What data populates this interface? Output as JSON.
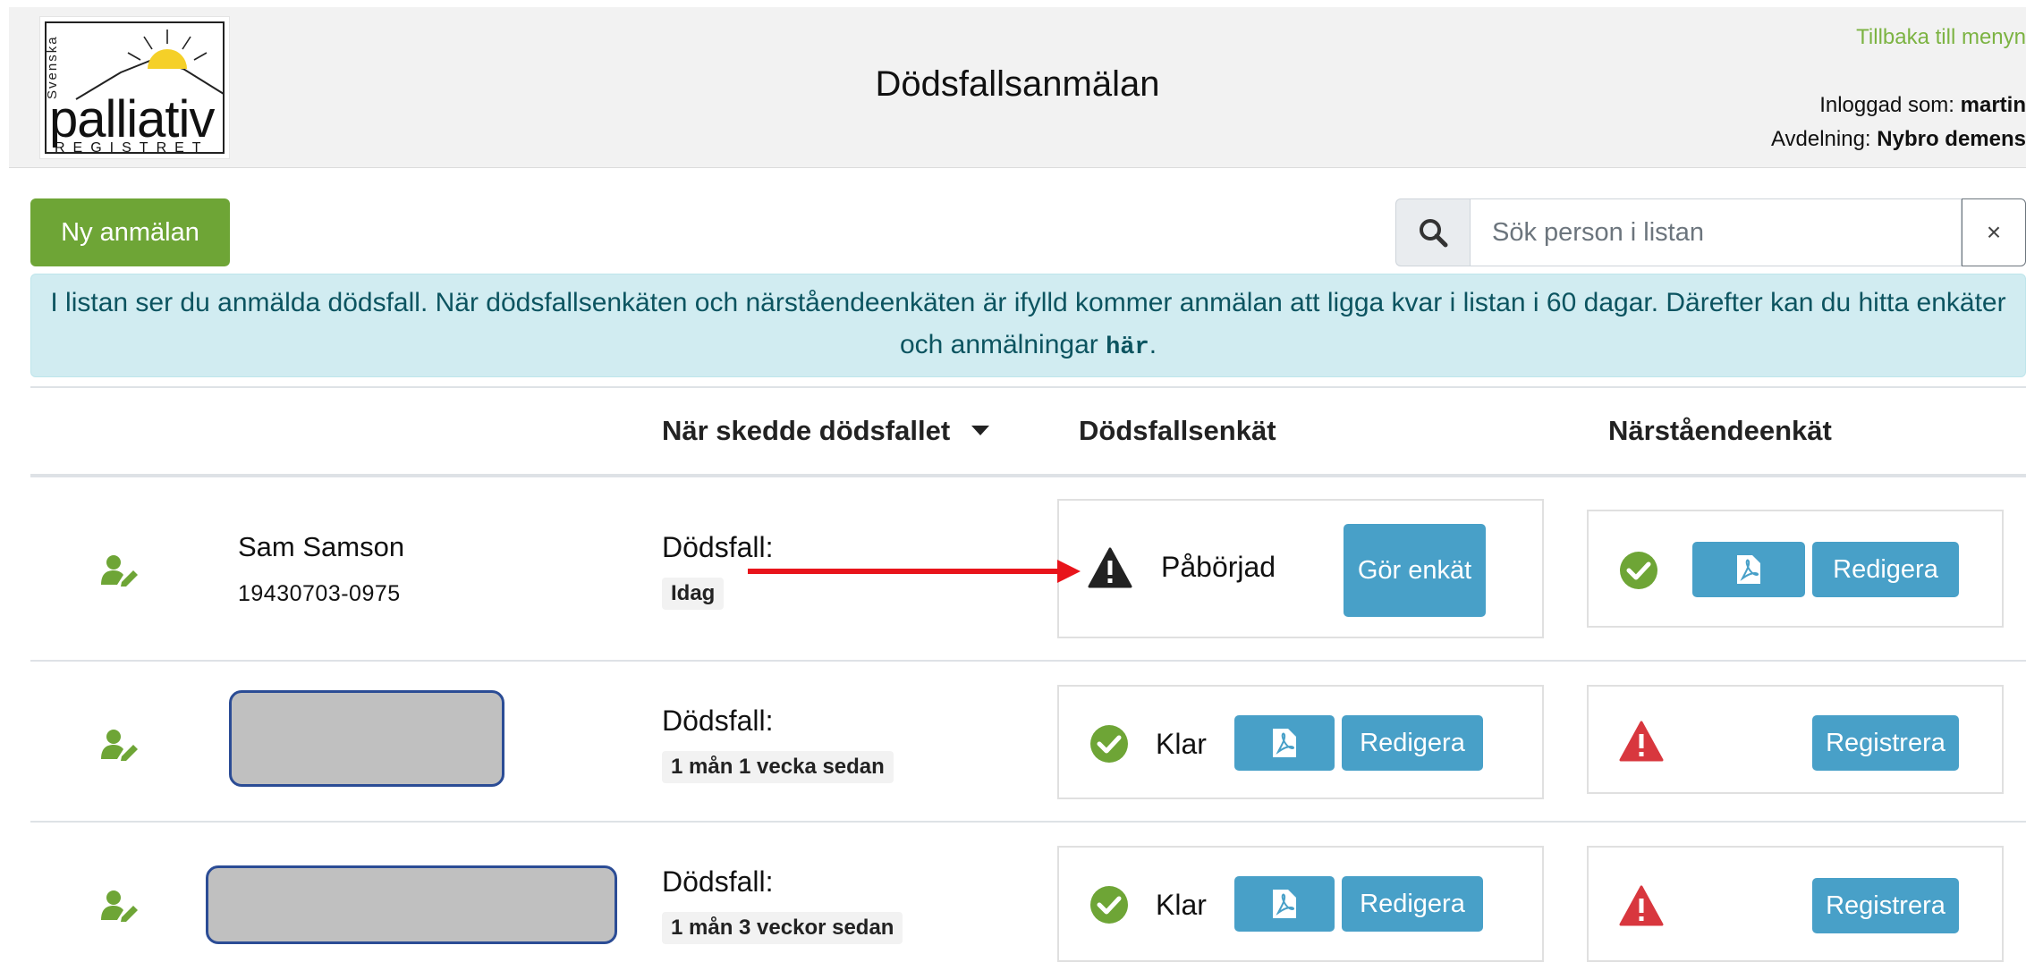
{
  "header": {
    "logo": {
      "top_text": "Svenska",
      "main_text": "palliativ",
      "sub_text": "REGISTRET"
    },
    "title": "Dödsfallsanmälan",
    "back_link": "Tillbaka till menyn",
    "logged_in_label": "Inloggad som:",
    "logged_in_user": "martin",
    "department_label": "Avdelning:",
    "department_value": "Nybro demens"
  },
  "toolbar": {
    "new_button": "Ny anmälan",
    "search_placeholder": "Sök person i listan",
    "clear_label": "×"
  },
  "info": {
    "text": "I listan ser du anmälda dödsfall. När dödsfallsenkäten och närståendeenkäten är ifylld kommer anmälan att ligga kvar i listan i 60 dagar. Därefter kan du hitta enkäter och anmälningar ",
    "link": "här",
    "end": "."
  },
  "table": {
    "headers": {
      "when": "När skedde dödsfallet",
      "death_survey": "Dödsfallsenkät",
      "relative_survey": "Närståendeenkät"
    },
    "rows": [
      {
        "name": "Sam Samson",
        "personal_number": "19430703-0975",
        "death_label": "Dödsfall:",
        "when": "Idag",
        "death_survey_status": "Påbörjad",
        "death_survey_button": "Gör enkät",
        "relative_edit_button": "Redigera"
      },
      {
        "death_label": "Dödsfall:",
        "when": "1 mån 1 vecka sedan",
        "death_survey_status": "Klar",
        "death_edit_button": "Redigera",
        "relative_register_button": "Registrera"
      },
      {
        "death_label": "Dödsfall:",
        "when": "1 mån 3 veckor sedan",
        "death_survey_status": "Klar",
        "death_edit_button": "Redigera",
        "relative_register_button": "Registrera"
      }
    ]
  },
  "colors": {
    "brand_green": "#6ea536",
    "link_green": "#7cb342",
    "button_blue": "#48a0c8",
    "success_green": "#6ea536",
    "danger_red": "#d8373e",
    "info_bg": "#d1ecf1",
    "annotation_arrow": "#e8141b"
  }
}
